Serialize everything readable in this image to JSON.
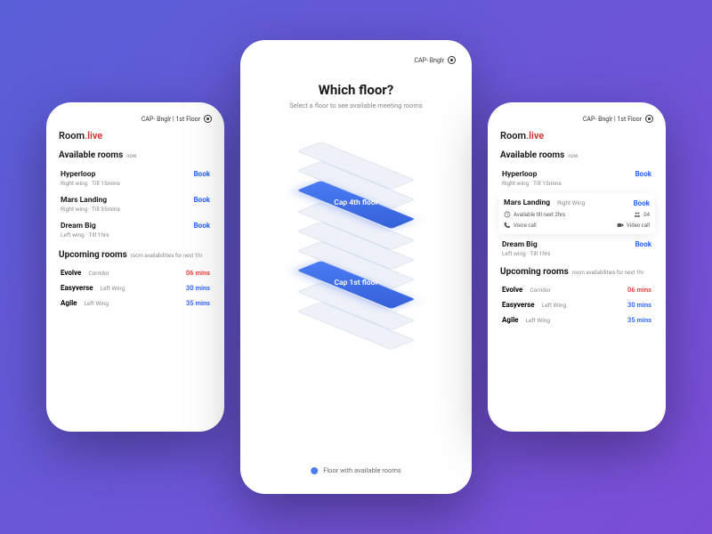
{
  "brand": {
    "room": "Room",
    "live": ".live"
  },
  "location": {
    "short": "CAP- Bnglr",
    "full": "CAP- Bnglr | 1st Floor"
  },
  "leftScreen": {
    "available_title": "Available rooms",
    "available_sub": "now",
    "rooms": [
      {
        "name": "Hyperloop",
        "meta": "Right wing · Till 15mins",
        "action": "Book"
      },
      {
        "name": "Mars Landing",
        "meta": "Right wing · Till 35mins",
        "action": "Book"
      },
      {
        "name": "Dream Big",
        "meta": "Left wing · Till 1hrs",
        "action": "Book"
      }
    ],
    "upcoming_title": "Upcoming rooms",
    "upcoming_sub": "room availabilities for next 1hr",
    "upcoming": [
      {
        "name": "Evolve",
        "loc": "Corridor",
        "time": "06 mins",
        "color": "red"
      },
      {
        "name": "Easyverse",
        "loc": "Left Wing",
        "time": "30 mins",
        "color": "blue"
      },
      {
        "name": "Agile",
        "loc": "Left Wing",
        "time": "35 mins",
        "color": "blue"
      }
    ]
  },
  "centerScreen": {
    "title": "Which floor?",
    "subtitle": "Select a floor to see available meeting rooms",
    "floors": [
      {
        "label": "Cap 4th floor"
      },
      {
        "label": "Cap 1st floor"
      }
    ],
    "legend": "Floor with available rooms"
  },
  "rightScreen": {
    "available_title": "Available rooms",
    "available_sub": "now",
    "rooms": [
      {
        "name": "Hyperloop",
        "meta": "Right wing · Till 15mins",
        "action": "Book"
      }
    ],
    "expanded": {
      "name": "Mars Landing",
      "wing": "Right Wing",
      "action": "Book",
      "avail": "Available till next 2hrs",
      "cap_icon": "people",
      "cap": "04",
      "voice": "Voice call",
      "video": "Video call"
    },
    "rooms_after": [
      {
        "name": "Dream Big",
        "meta": "Left wing · Till 1hrs",
        "action": "Book"
      }
    ],
    "upcoming_title": "Upcoming rooms",
    "upcoming_sub": "room availabilities for next 1hr",
    "upcoming": [
      {
        "name": "Evolve",
        "loc": "Corridor",
        "time": "06 mins",
        "color": "red"
      },
      {
        "name": "Easyverse",
        "loc": "Left Wing",
        "time": "30 mins",
        "color": "blue"
      },
      {
        "name": "Agile",
        "loc": "Left Wing",
        "time": "35 mins",
        "color": "blue"
      }
    ]
  }
}
